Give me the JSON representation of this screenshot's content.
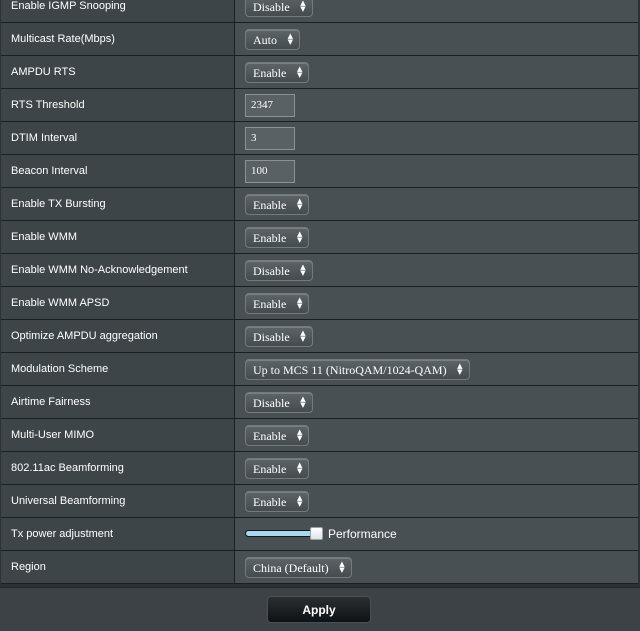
{
  "settings": [
    {
      "label": "Enable IGMP Snooping",
      "type": "select",
      "value": "Disable"
    },
    {
      "label": "Multicast Rate(Mbps)",
      "type": "select",
      "value": "Auto"
    },
    {
      "label": "AMPDU RTS",
      "type": "select",
      "value": "Enable"
    },
    {
      "label": "RTS Threshold",
      "type": "text",
      "value": "2347"
    },
    {
      "label": "DTIM Interval",
      "type": "text",
      "value": "3"
    },
    {
      "label": "Beacon Interval",
      "type": "text",
      "value": "100"
    },
    {
      "label": "Enable TX Bursting",
      "type": "select",
      "value": "Enable"
    },
    {
      "label": "Enable WMM",
      "type": "select",
      "value": "Enable"
    },
    {
      "label": "Enable WMM No-Acknowledgement",
      "type": "select",
      "value": "Disable"
    },
    {
      "label": "Enable WMM APSD",
      "type": "select",
      "value": "Enable"
    },
    {
      "label": "Optimize AMPDU aggregation",
      "type": "select",
      "value": "Disable"
    },
    {
      "label": "Modulation Scheme",
      "type": "select",
      "value": "Up to MCS 11 (NitroQAM/1024-QAM)"
    },
    {
      "label": "Airtime Fairness",
      "type": "select",
      "value": "Disable"
    },
    {
      "label": "Multi-User MIMO",
      "type": "select",
      "value": "Enable"
    },
    {
      "label": "802.11ac Beamforming",
      "type": "select",
      "value": "Enable"
    },
    {
      "label": "Universal Beamforming",
      "type": "select",
      "value": "Enable"
    },
    {
      "label": "Tx power adjustment",
      "type": "slider",
      "level": 1.0,
      "level_text": "Performance"
    },
    {
      "label": "Region",
      "type": "select",
      "value": "China (Default)"
    }
  ],
  "apply_label": "Apply",
  "icons": {
    "select_arrow": "up-down-chevron-icon"
  },
  "colors": {
    "label_bg": "#3e4549",
    "value_bg": "#495054",
    "slider_fill": "#a9d7ef",
    "page_bg": "#2b3134"
  }
}
